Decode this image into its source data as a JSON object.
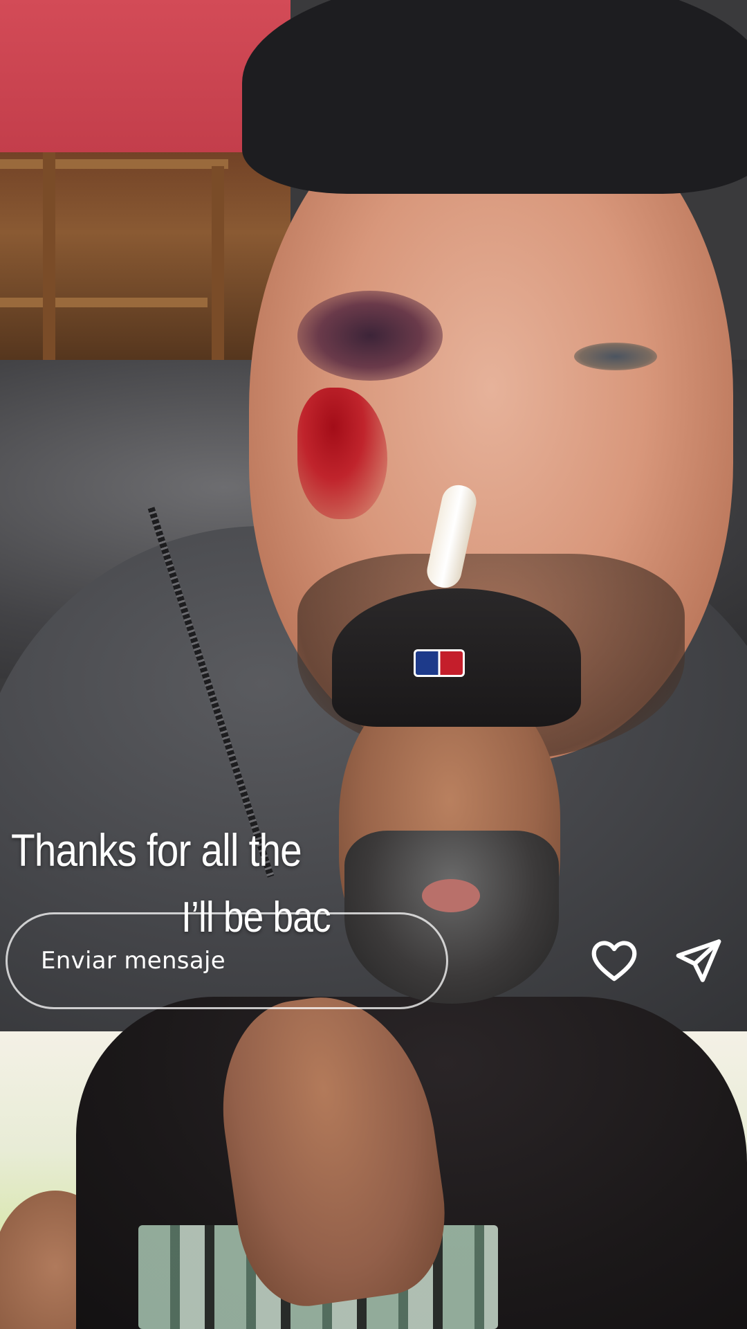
{
  "story": {
    "caption_line_1": "Thanks for all the",
    "caption_line_2": "I’ll be bac"
  },
  "reply_bar": {
    "message_placeholder": "Enviar mensaje"
  },
  "icons": {
    "like": "heart-icon",
    "share": "paper-plane-icon"
  },
  "colors": {
    "text": "#ffffff",
    "input_border": "#ffffff"
  }
}
